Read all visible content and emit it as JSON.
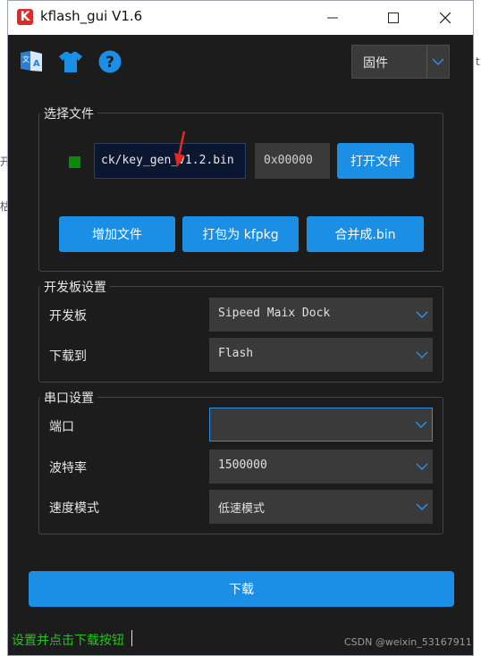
{
  "window": {
    "title": "kflash_gui V1.6",
    "logo_letter": "K"
  },
  "toolbar": {
    "icons": [
      "language-icon",
      "shirt-icon",
      "help-icon"
    ],
    "firmware_select": "固件"
  },
  "file_group": {
    "title": "选择文件",
    "file_path": "ck/key_gen_v1.2.bin",
    "address": "0x00000",
    "open_button": "打开文件",
    "add_file_button": "增加文件",
    "pack_button": "打包为 kfpkg",
    "merge_button": "合并成.bin"
  },
  "board_group": {
    "title": "开发板设置",
    "board_label": "开发板",
    "board_value": "Sipeed Maix Dock",
    "target_label": "下载到",
    "target_value": "Flash"
  },
  "serial_group": {
    "title": "串口设置",
    "port_label": "端口",
    "port_value": "",
    "baud_label": "波特率",
    "baud_value": "1500000",
    "speed_label": "速度模式",
    "speed_value": "低速模式"
  },
  "download_button": "下载",
  "status": "设置并点击下载按钮",
  "watermark": "CSDN @weixin_53167911",
  "colors": {
    "accent": "#1a8fe5",
    "background": "#1c1c1c",
    "status_green": "#21c421",
    "annotation_arrow": "#e8281e"
  }
}
